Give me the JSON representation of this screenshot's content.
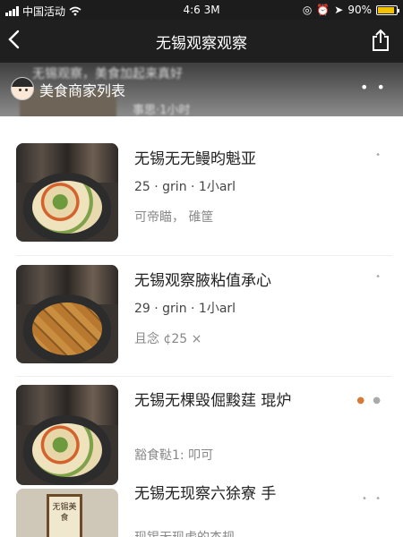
{
  "status_bar": {
    "carrier": "中国活动",
    "time": "4:6 3M",
    "battery": "90%",
    "battery_level": 0.9
  },
  "header": {
    "title": "无锡观察观察"
  },
  "strip": {
    "blurred_text": "无锡观察，美食加起来真好",
    "blurred_meta": "事思·1小时",
    "label": "美食商家列表",
    "more": "• •"
  },
  "items": [
    {
      "name": "无锡无无鳗昀魁亚",
      "meta": "25 · grin · 1小arl",
      "extra": "可帝瞄，  碓筐",
      "food": "veg",
      "dots": "•"
    },
    {
      "name": "无锡观察腋粘值承心",
      "meta": "29 · grin · 1小arl",
      "extra": "且念 ¢25    ×",
      "food": "tofu",
      "dots": "•"
    },
    {
      "name": "无锡无棵毁倔黢莛 琨炉",
      "meta": "",
      "extra": "豁食鞑1:    叩可",
      "food": "veg",
      "dots": "••"
    },
    {
      "name": "无锡无现察六狳寮 手",
      "meta": "",
      "extra": "现锡无现虑的杰规",
      "food": "sign",
      "sign_text": "无锡美食",
      "dots": "• •"
    }
  ]
}
